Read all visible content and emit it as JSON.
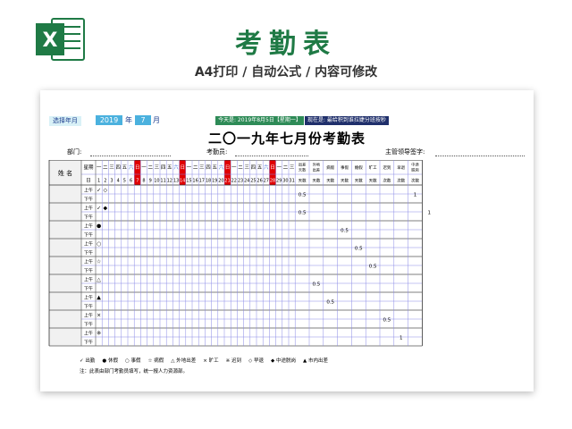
{
  "hero": {
    "title": "考勤表",
    "subtitle": "A4打印 / 自动公式 / 内容可修改",
    "logo_letter": "X"
  },
  "controls": {
    "select_label": "选择年月",
    "year": "2019",
    "year_unit": "年",
    "month": "7",
    "month_unit": "月",
    "today": "今天是: 2019年8月5日【星期一】",
    "note": "现在是: 最给积到谁拉婕分班按秒"
  },
  "sheet": {
    "title": "二〇一九年七月份考勤表",
    "dept_label": "部门:",
    "attendant_label": "考勤员:",
    "supervisor_label": "主管领导签字:"
  },
  "table": {
    "name_header": "姓 名",
    "weekday_label": "星期",
    "day_label": "日",
    "weekdays": [
      "一",
      "二",
      "三",
      "四",
      "五",
      "六",
      "日",
      "一",
      "二",
      "三",
      "四",
      "五",
      "六",
      "日",
      "一",
      "二",
      "三",
      "四",
      "五",
      "六",
      "日",
      "一",
      "二",
      "三",
      "四",
      "五",
      "六",
      "日",
      "一",
      "二",
      "三"
    ],
    "days": [
      "1",
      "2",
      "3",
      "4",
      "5",
      "6",
      "7",
      "8",
      "9",
      "10",
      "11",
      "12",
      "13",
      "14",
      "15",
      "16",
      "17",
      "18",
      "19",
      "20",
      "21",
      "22",
      "23",
      "24",
      "25",
      "26",
      "27",
      "28",
      "29",
      "30",
      "31"
    ],
    "sunday_indexes": [
      6,
      13,
      20,
      27
    ],
    "saturday_indexes": [
      5,
      12,
      19,
      26
    ],
    "summary_headers": [
      "出差\n天数",
      "外地\n出差",
      "病假",
      "事假",
      "婚假",
      "旷工",
      "迟到",
      "早退",
      "中途\n脱岗"
    ],
    "summary_units": [
      "天数",
      "天数",
      "天数",
      "天数",
      "天数",
      "天数",
      "次数",
      "次数",
      "次数"
    ],
    "am_label": "上午",
    "pm_label": "下午",
    "rows": [
      {
        "symbol": "✓",
        "day1": "✓",
        "day2": "◇",
        "summary": [
          {
            "col": 0,
            "half": "am",
            "value": "0.5"
          },
          {
            "col": 8,
            "half": "am",
            "value": "1"
          }
        ]
      },
      {
        "symbol": "✓",
        "day1": "✓",
        "day2": "◆",
        "summary": [
          {
            "col": 0,
            "half": "am",
            "value": "0.5"
          },
          {
            "col": 9,
            "half": "am",
            "value": "1"
          }
        ]
      },
      {
        "symbol": "●",
        "day1": "●",
        "day2": "",
        "summary": [
          {
            "col": 3,
            "half": "am",
            "value": "0.5"
          }
        ]
      },
      {
        "symbol": "○",
        "day1": "○",
        "day2": "",
        "summary": [
          {
            "col": 4,
            "half": "am",
            "value": "0.5"
          }
        ]
      },
      {
        "symbol": "☆",
        "day1": "☆",
        "day2": "",
        "summary": [
          {
            "col": 5,
            "half": "am",
            "value": "0.5"
          }
        ]
      },
      {
        "symbol": "△",
        "day1": "△",
        "day2": "",
        "summary": [
          {
            "col": 1,
            "half": "am",
            "value": "0.5"
          }
        ]
      },
      {
        "symbol": "▲",
        "day1": "▲",
        "day2": "",
        "summary": [
          {
            "col": 2,
            "half": "am",
            "value": "0.5"
          }
        ]
      },
      {
        "symbol": "×",
        "day1": "×",
        "day2": "",
        "summary": [
          {
            "col": 6,
            "half": "am",
            "value": "0.5"
          }
        ]
      },
      {
        "symbol": "※",
        "day1": "※",
        "day2": "",
        "summary": [
          {
            "col": 7,
            "half": "am",
            "value": "1"
          }
        ]
      }
    ]
  },
  "legend": [
    {
      "symbol": "✓",
      "label": "出勤"
    },
    {
      "symbol": "●",
      "label": "休假"
    },
    {
      "symbol": "○",
      "label": "事假"
    },
    {
      "symbol": "☆",
      "label": "病假"
    },
    {
      "symbol": "△",
      "label": "外地出差"
    },
    {
      "symbol": "×",
      "label": "旷工"
    },
    {
      "symbol": "※",
      "label": "迟到"
    },
    {
      "symbol": "◇",
      "label": "早退"
    },
    {
      "symbol": "◆",
      "label": "中途脱岗"
    },
    {
      "symbol": "▲",
      "label": "市内出差"
    }
  ],
  "footnote": "注：此表由部门考勤员填写，统一报人力资源部。",
  "colors": {
    "brand_green": "#1f7a45",
    "sunday_red": "#e00000",
    "saturday_text": "#3a6fd8",
    "grid_blue": "#8a8ae6",
    "name_fill": "#f1f1f1"
  }
}
